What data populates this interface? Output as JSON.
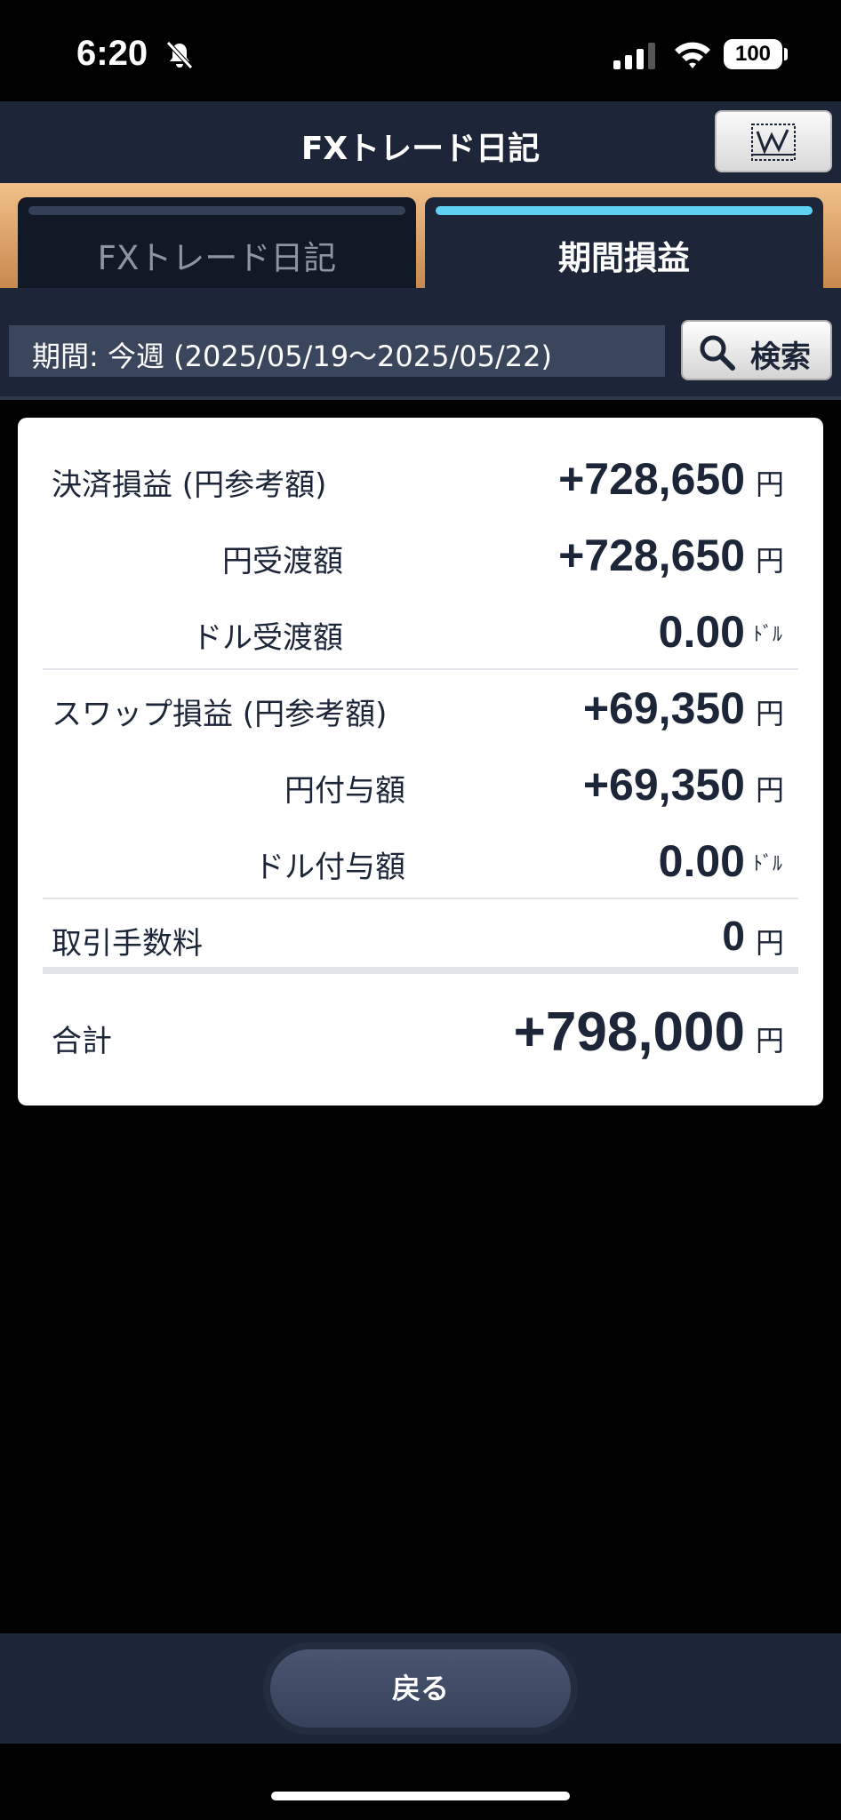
{
  "status_bar": {
    "time": "6:20",
    "battery": "100"
  },
  "header": {
    "title": "FXトレード日記"
  },
  "tabs": [
    {
      "label": "FXトレード日記",
      "active": false
    },
    {
      "label": "期間損益",
      "active": true
    }
  ],
  "period": {
    "text": "期間: 今週 (2025/05/19～2025/05/22)",
    "search_label": "検索"
  },
  "summary": {
    "settlement_label": "決済損益 (円参考額)",
    "settlement_value": "+728,650",
    "settlement_unit": "円",
    "yen_delivery_label": "円受渡額",
    "yen_delivery_value": "+728,650",
    "yen_delivery_unit": "円",
    "dollar_delivery_label": "ドル受渡額",
    "dollar_delivery_value": "0.00",
    "dollar_delivery_unit": "ﾄﾞﾙ",
    "swap_label": "スワップ損益 (円参考額)",
    "swap_value": "+69,350",
    "swap_unit": "円",
    "yen_grant_label": "円付与額",
    "yen_grant_value": "+69,350",
    "yen_grant_unit": "円",
    "dollar_grant_label": "ドル付与額",
    "dollar_grant_value": "0.00",
    "dollar_grant_unit": "ﾄﾞﾙ",
    "fee_label": "取引手数料",
    "fee_value": "0",
    "fee_unit": "円",
    "total_label": "合計",
    "total_value": "+798,000",
    "total_unit": "円"
  },
  "footer": {
    "back_label": "戻る"
  },
  "colors": {
    "header_bg": "#1c2638",
    "accent_tab": "#5fd2f2",
    "tab_band": "#e0a86c"
  }
}
